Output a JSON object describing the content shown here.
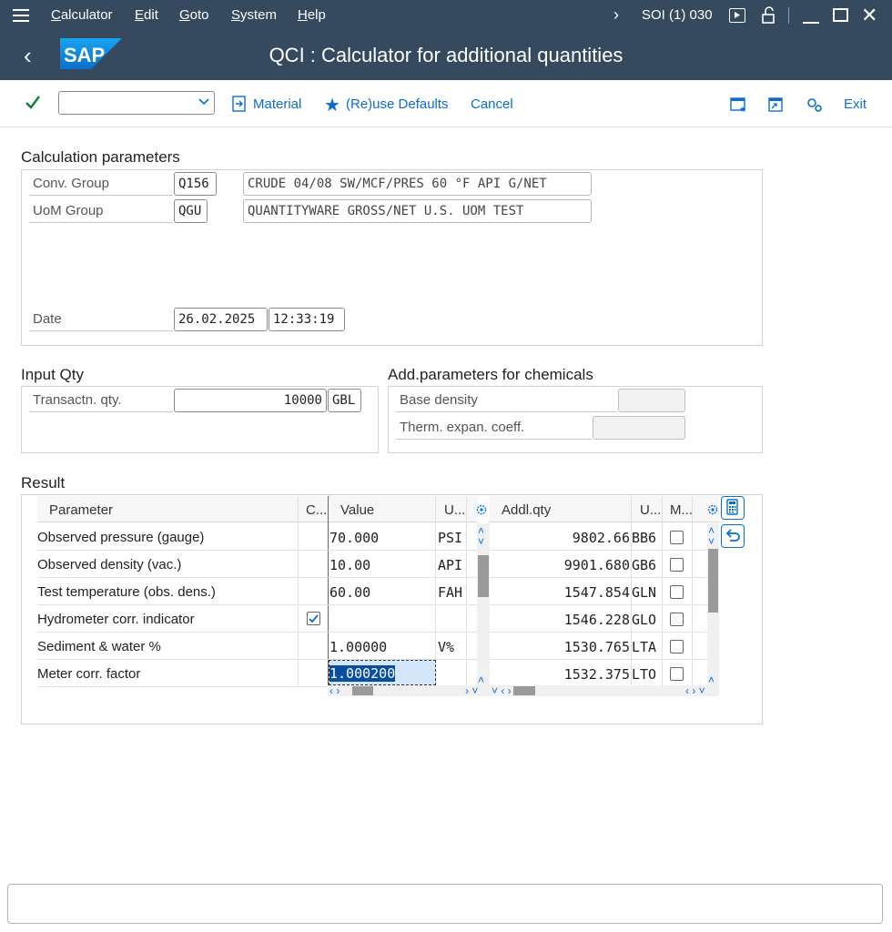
{
  "menubar": {
    "items": [
      "Calculator",
      "Edit",
      "Goto",
      "System",
      "Help"
    ],
    "system_info": "SOI (1) 030"
  },
  "title": "QCI : Calculator for additional quantities",
  "toolbar": {
    "material_label": "Material",
    "reuse_label": "(Re)use Defaults",
    "cancel_label": "Cancel",
    "exit_label": "Exit"
  },
  "calc_params": {
    "heading": "Calculation parameters",
    "conv_group_label": "Conv. Group",
    "conv_group_value": "Q156",
    "conv_group_desc": "CRUDE 04/08 SW/MCF/PRES 60 °F API G/NET",
    "uom_group_label": "UoM Group",
    "uom_group_value": "QGU",
    "uom_group_desc": "QUANTITYWARE GROSS/NET U.S. UOM TEST",
    "date_label": "Date",
    "date_value": "26.02.2025",
    "time_value": "12:33:19"
  },
  "input_qty": {
    "heading": "Input Qty",
    "label": "Transactn. qty.",
    "value": "10000",
    "unit": "GBL"
  },
  "chem_params": {
    "heading": "Add.parameters for chemicals",
    "base_density_label": "Base density",
    "therm_label": "Therm. expan. coeff."
  },
  "result": {
    "heading": "Result",
    "left_headers": {
      "parameter": "Parameter",
      "c": "C...",
      "value": "Value",
      "u": "U..."
    },
    "right_headers": {
      "qty": "Addl.qty",
      "u": "U...",
      "m": "M..."
    },
    "params": [
      {
        "name": "Observed pressure (gauge)",
        "value": "70.000",
        "unit": "PSI",
        "checked": false
      },
      {
        "name": "Observed density (vac.)",
        "value": "10.00",
        "unit": "API",
        "checked": false
      },
      {
        "name": "Test temperature (obs. dens.)",
        "value": "60.00",
        "unit": "FAH",
        "checked": false
      },
      {
        "name": "Hydrometer corr. indicator",
        "value": "",
        "unit": "",
        "checked": true
      },
      {
        "name": "Sediment & water %",
        "value": "1.00000",
        "unit": "V%",
        "checked": false
      },
      {
        "name": "Meter corr. factor",
        "value": "1.000200",
        "unit": "",
        "checked": false
      }
    ],
    "quantities": [
      {
        "qty": "9802.66",
        "unit": "BB6"
      },
      {
        "qty": "9901.680",
        "unit": "GB6"
      },
      {
        "qty": "1547.854",
        "unit": "GLN"
      },
      {
        "qty": "1546.228",
        "unit": "GLO"
      },
      {
        "qty": "1530.765",
        "unit": "LTA"
      },
      {
        "qty": "1532.375",
        "unit": "LTO"
      }
    ]
  },
  "colors": {
    "shell": "#354a5f",
    "accent": "#0a6ed1",
    "selection": "#0a4f9e",
    "check": "#107e3e"
  }
}
